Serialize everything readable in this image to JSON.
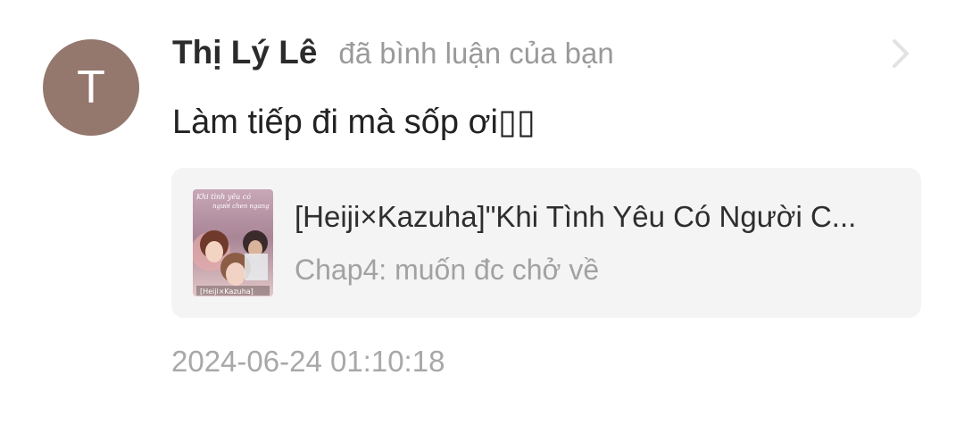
{
  "notification": {
    "avatar_initial": "T",
    "avatar_color": "#94776d",
    "user_name": "Thị Lý Lê",
    "action_text": "đã bình luận của bạn",
    "comment": "Làm tiếp đi mà sốp ơi▯▯",
    "chevron_icon": "chevron-right-icon",
    "story": {
      "title": "[Heiji×Kazuha]\"Khi Tình Yêu Có Người C...",
      "chapter": "Chap4: muốn đc chở về",
      "cover_text_top": "Khi tình yêu có",
      "cover_text_mid": "người chen ngang",
      "cover_text_bottom": "[Heiji×Kazuha]"
    },
    "timestamp": "2024-06-24 01:10:18"
  }
}
